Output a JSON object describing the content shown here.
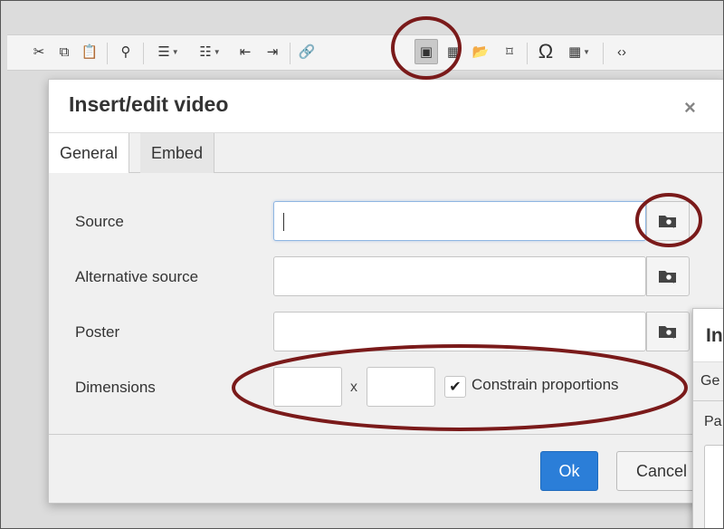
{
  "toolbar": {
    "items": [
      {
        "name": "cut-icon",
        "glyph": "✂"
      },
      {
        "name": "copy-icon",
        "glyph": "⧉"
      },
      {
        "name": "paste-icon",
        "glyph": "📋"
      },
      {
        "name": "find-icon",
        "glyph": "⚲"
      },
      {
        "name": "bullet-list-icon",
        "glyph": "☰"
      },
      {
        "name": "numbered-list-icon",
        "glyph": "☷"
      },
      {
        "name": "outdent-icon",
        "glyph": "⇤"
      },
      {
        "name": "indent-icon",
        "glyph": "⇥"
      },
      {
        "name": "link-icon",
        "glyph": "🔗"
      },
      {
        "name": "image-icon",
        "glyph": "▣"
      },
      {
        "name": "media-icon",
        "glyph": "▦"
      },
      {
        "name": "file-browser-icon",
        "glyph": "📂"
      },
      {
        "name": "bookmark-icon",
        "glyph": "⌑"
      },
      {
        "name": "special-char-icon",
        "glyph": "Ω"
      },
      {
        "name": "table-icon",
        "glyph": "▦"
      },
      {
        "name": "source-code-icon",
        "glyph": "‹›"
      }
    ]
  },
  "dialog": {
    "title": "Insert/edit video",
    "close_glyph": "×",
    "tabs": [
      {
        "label": "General",
        "active": true
      },
      {
        "label": "Embed",
        "active": false
      }
    ],
    "fields": {
      "source_label": "Source",
      "alt_source_label": "Alternative source",
      "poster_label": "Poster",
      "dimensions_label": "Dimensions",
      "dimensions_separator": "x",
      "constrain_label": "Constrain proportions",
      "constrain_checked": true,
      "source_value": "",
      "alt_source_value": "",
      "poster_value": "",
      "width_value": "",
      "height_value": ""
    },
    "buttons": {
      "ok": "Ok",
      "cancel": "Cancel"
    }
  },
  "dialog2": {
    "title": "In",
    "tab": "Ge",
    "label": "Pa"
  },
  "colors": {
    "annotation": "#7a1a1a",
    "primary_button": "#2b7ed8"
  }
}
